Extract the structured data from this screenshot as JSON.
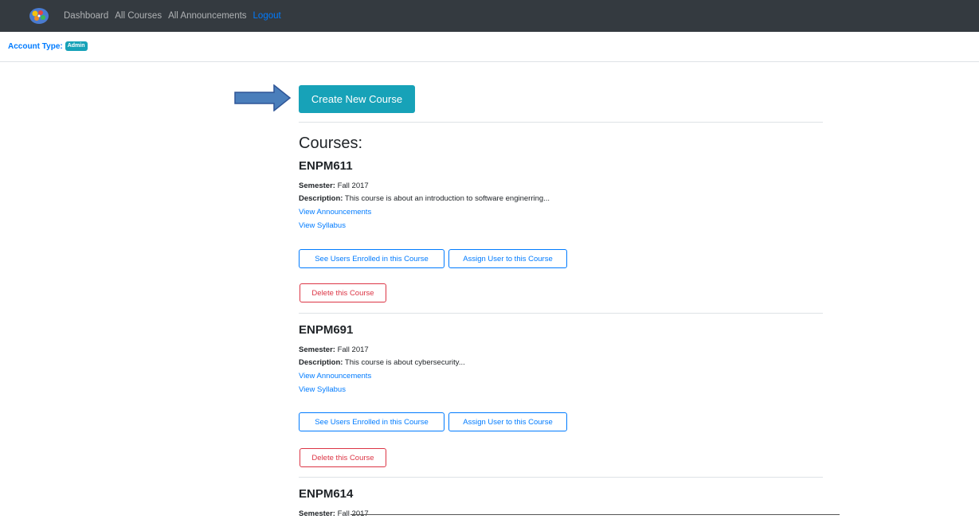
{
  "navbar": {
    "logo_icon": "brain-gears-logo",
    "links": [
      "Dashboard",
      "All Courses",
      "All Announcements"
    ],
    "logout": "Logout"
  },
  "account": {
    "label": "Account Type:",
    "badge": "Admin"
  },
  "create_button": "Create New Course",
  "courses_heading": "Courses:",
  "labels": {
    "semester": "Semester:",
    "description": "Description:",
    "view_announcements": "View Announcements",
    "view_syllabus": "View Syllabus",
    "see_users": "See Users Enrolled in this Course",
    "assign_user": "Assign User to this Course",
    "delete": "Delete this Course"
  },
  "courses": [
    {
      "code": "ENPM611",
      "semester": "Fall 2017",
      "description": "This course is about an introduction to software enginerring..."
    },
    {
      "code": "ENPM691",
      "semester": "Fall 2017",
      "description": "This course is about cybersecurity..."
    },
    {
      "code": "ENPM614",
      "semester": "Fall 2017"
    }
  ],
  "colors": {
    "navbar": "#343a40",
    "info": "#17a2b8",
    "primary": "#007bff",
    "danger": "#dc3545"
  }
}
